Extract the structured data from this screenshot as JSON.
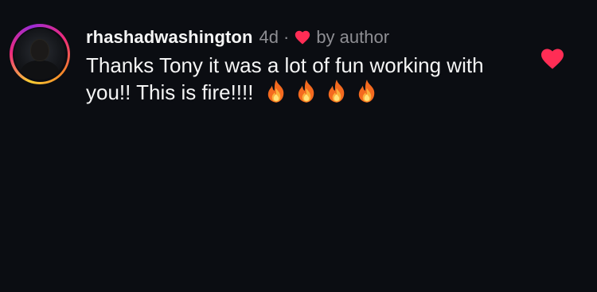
{
  "comment": {
    "username": "rhashadwashington",
    "time": "4d",
    "separator": "·",
    "author_label": "by author",
    "text": "Thanks Tony it was a lot of fun working with you!! This is fire!!!!",
    "emoji_count": 4,
    "emoji": "fire-emoji",
    "liked_by_author": true,
    "liked": true
  },
  "colors": {
    "background": "#0b0d12",
    "heart": "#ff2d55",
    "muted_text": "#8e8e93",
    "primary_text": "#f5f5f5"
  },
  "icons": {
    "small_heart": "heart-icon",
    "like": "heart-filled-icon",
    "avatar": "profile-photo"
  }
}
